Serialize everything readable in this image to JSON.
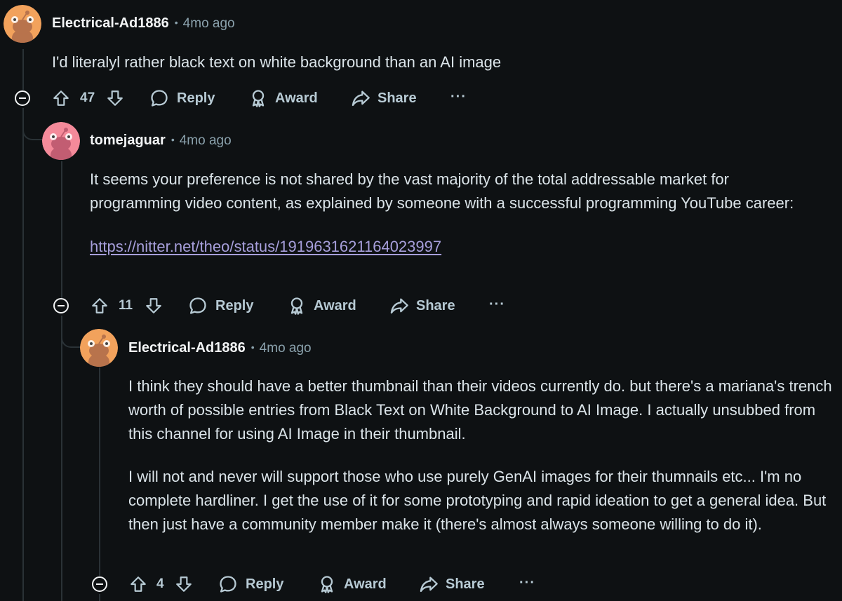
{
  "comments": [
    {
      "author": "Electrical-Ad1886",
      "separator": "•",
      "time": "4mo ago",
      "avatar_color": "#f2a25c",
      "paragraphs": [
        "I'd literalyl rather black text on white background than an AI image"
      ],
      "votes": "47",
      "actions": {
        "reply": "Reply",
        "award": "Award",
        "share": "Share",
        "more": "···"
      }
    },
    {
      "author": "tomejaguar",
      "separator": "•",
      "time": "4mo ago",
      "avatar_color": "#f48a9a",
      "paragraphs": [
        "It seems your preference is not shared by the vast majority of the total addressable market for programming video content, as explained by someone with a successful programming YouTube career:"
      ],
      "link": "https://nitter.net/theo/status/1919631621164023997",
      "votes": "11",
      "actions": {
        "reply": "Reply",
        "award": "Award",
        "share": "Share",
        "more": "···"
      }
    },
    {
      "author": "Electrical-Ad1886",
      "separator": "•",
      "time": "4mo ago",
      "avatar_color": "#f2a25c",
      "paragraphs": [
        "I think they should have a better thumbnail than their videos currently do. but there's a mariana's trench worth of possible entries from Black Text on White Background to AI Image. I actually unsubbed from this channel for using AI Image in their thumbnail.",
        "I will not and never will support those who use purely GenAI images for their thumnails etc... I'm no complete hardliner. I get the use of it for some prototyping and rapid ideation to get a general idea. But then just have a community member make it (there's almost always someone willing to do it)."
      ],
      "votes": "4",
      "actions": {
        "reply": "Reply",
        "award": "Award",
        "share": "Share",
        "more": "···"
      }
    }
  ],
  "icons": {
    "upvote": "arrow-up-outline",
    "downvote": "arrow-down-outline",
    "reply": "speech-bubble",
    "award": "award-ribbon",
    "share": "share-arrow",
    "collapse": "circle-minus"
  }
}
